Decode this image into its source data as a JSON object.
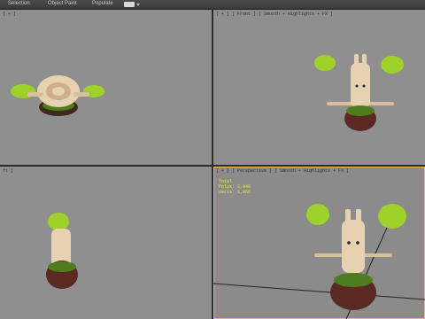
{
  "menubar": {
    "items": [
      "Selection",
      "Object Paint",
      "Populate"
    ]
  },
  "viewports": {
    "top": {
      "label": "[ + ]"
    },
    "front": {
      "label": "[ + ] [ Front ] [ Smooth + Highlights + FX ]"
    },
    "left": {
      "label": "ft ]"
    },
    "perspective": {
      "label": "[ + ] [ Perspective ] [ Smooth + Highlights + FX ]",
      "stats": {
        "title": "Total",
        "polys": "Polys: 2,048",
        "verts": "Verts: 1,066"
      }
    }
  },
  "colors": {
    "active_outline": "#e8c34a",
    "stats_text": "#f2e34b",
    "leaf": "#9ed12a",
    "bark": "#e6d2b0",
    "root": "#5a2a22"
  }
}
